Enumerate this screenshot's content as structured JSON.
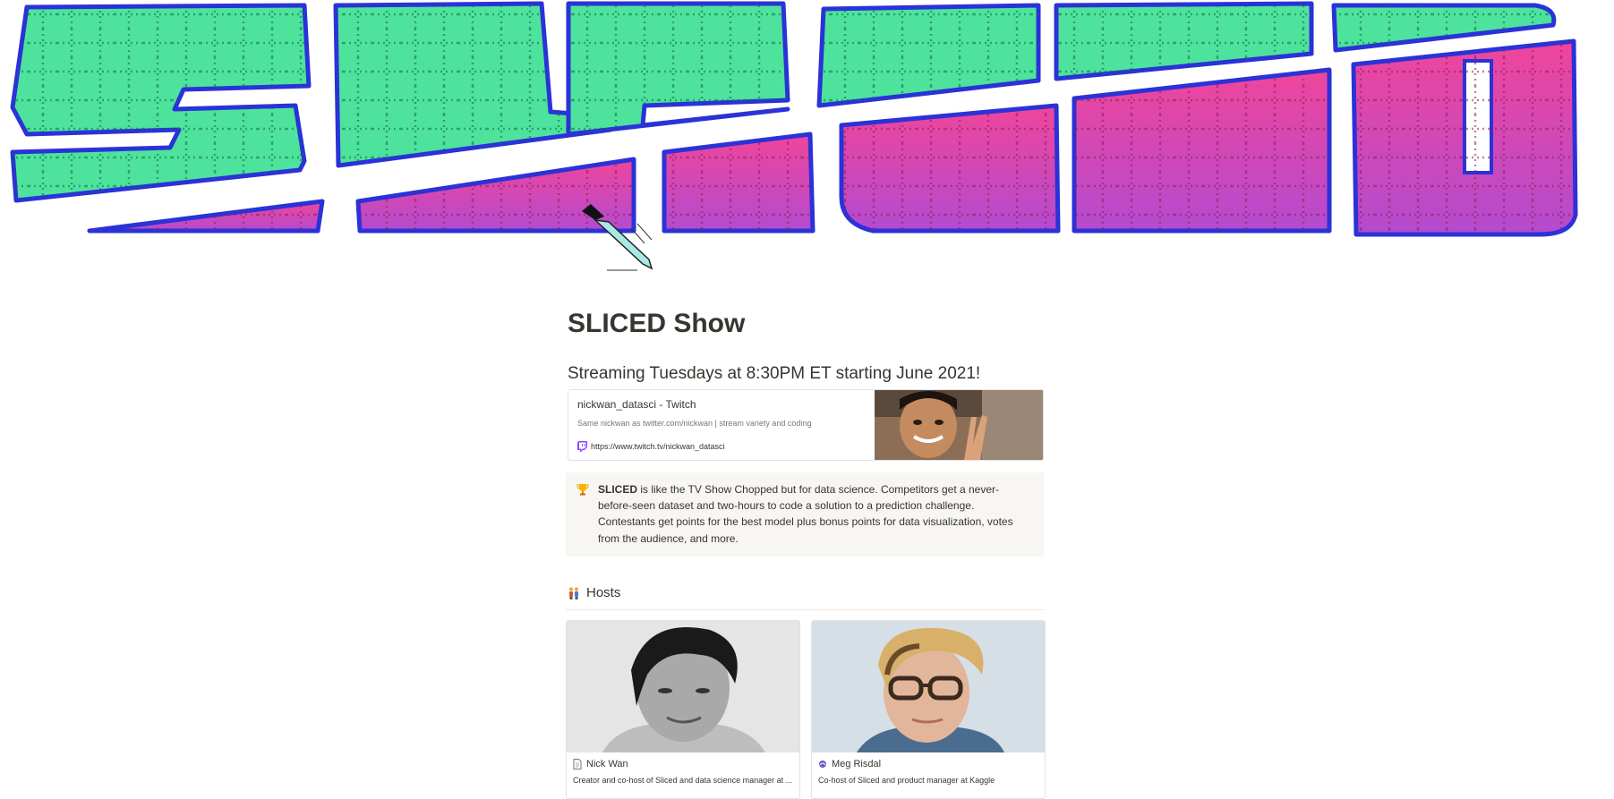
{
  "banner": {
    "logo_text": "SLICED",
    "colors": {
      "green": "#4ee39c",
      "pink": "#f0459b",
      "purple": "#9b4bd2",
      "outline": "#2a32d8",
      "grid": "#0f6b48"
    }
  },
  "page": {
    "title": "SLICED Show",
    "subtitle": "Streaming Tuesdays at 8:30PM ET starting June 2021!"
  },
  "bookmark": {
    "title": "nickwan_datasci - Twitch",
    "description": "Same nickwan as twitter.com/nickwan | stream variety and coding",
    "url": "https://www.twitch.tv/nickwan_datasci",
    "icon": "twitch-icon"
  },
  "callout": {
    "icon": "trophy-icon",
    "bold": "SLICED",
    "text": " is like the TV Show Chopped but for data science. Competitors get a never-before-seen dataset and two-hours to code a solution to a prediction challenge. Contestants get points for the best model plus bonus points for data visualization, votes from the audience, and more."
  },
  "hosts": {
    "heading": "Hosts",
    "icon": "couple-icon",
    "cards": [
      {
        "name": "Nick Wan",
        "icon": "page-icon",
        "description": "Creator and co-host of Sliced and data science manager at ..."
      },
      {
        "name": "Meg Risdal",
        "icon": "kaggle-bird-icon",
        "description": "Co-host of Sliced and product manager at Kaggle"
      }
    ]
  }
}
